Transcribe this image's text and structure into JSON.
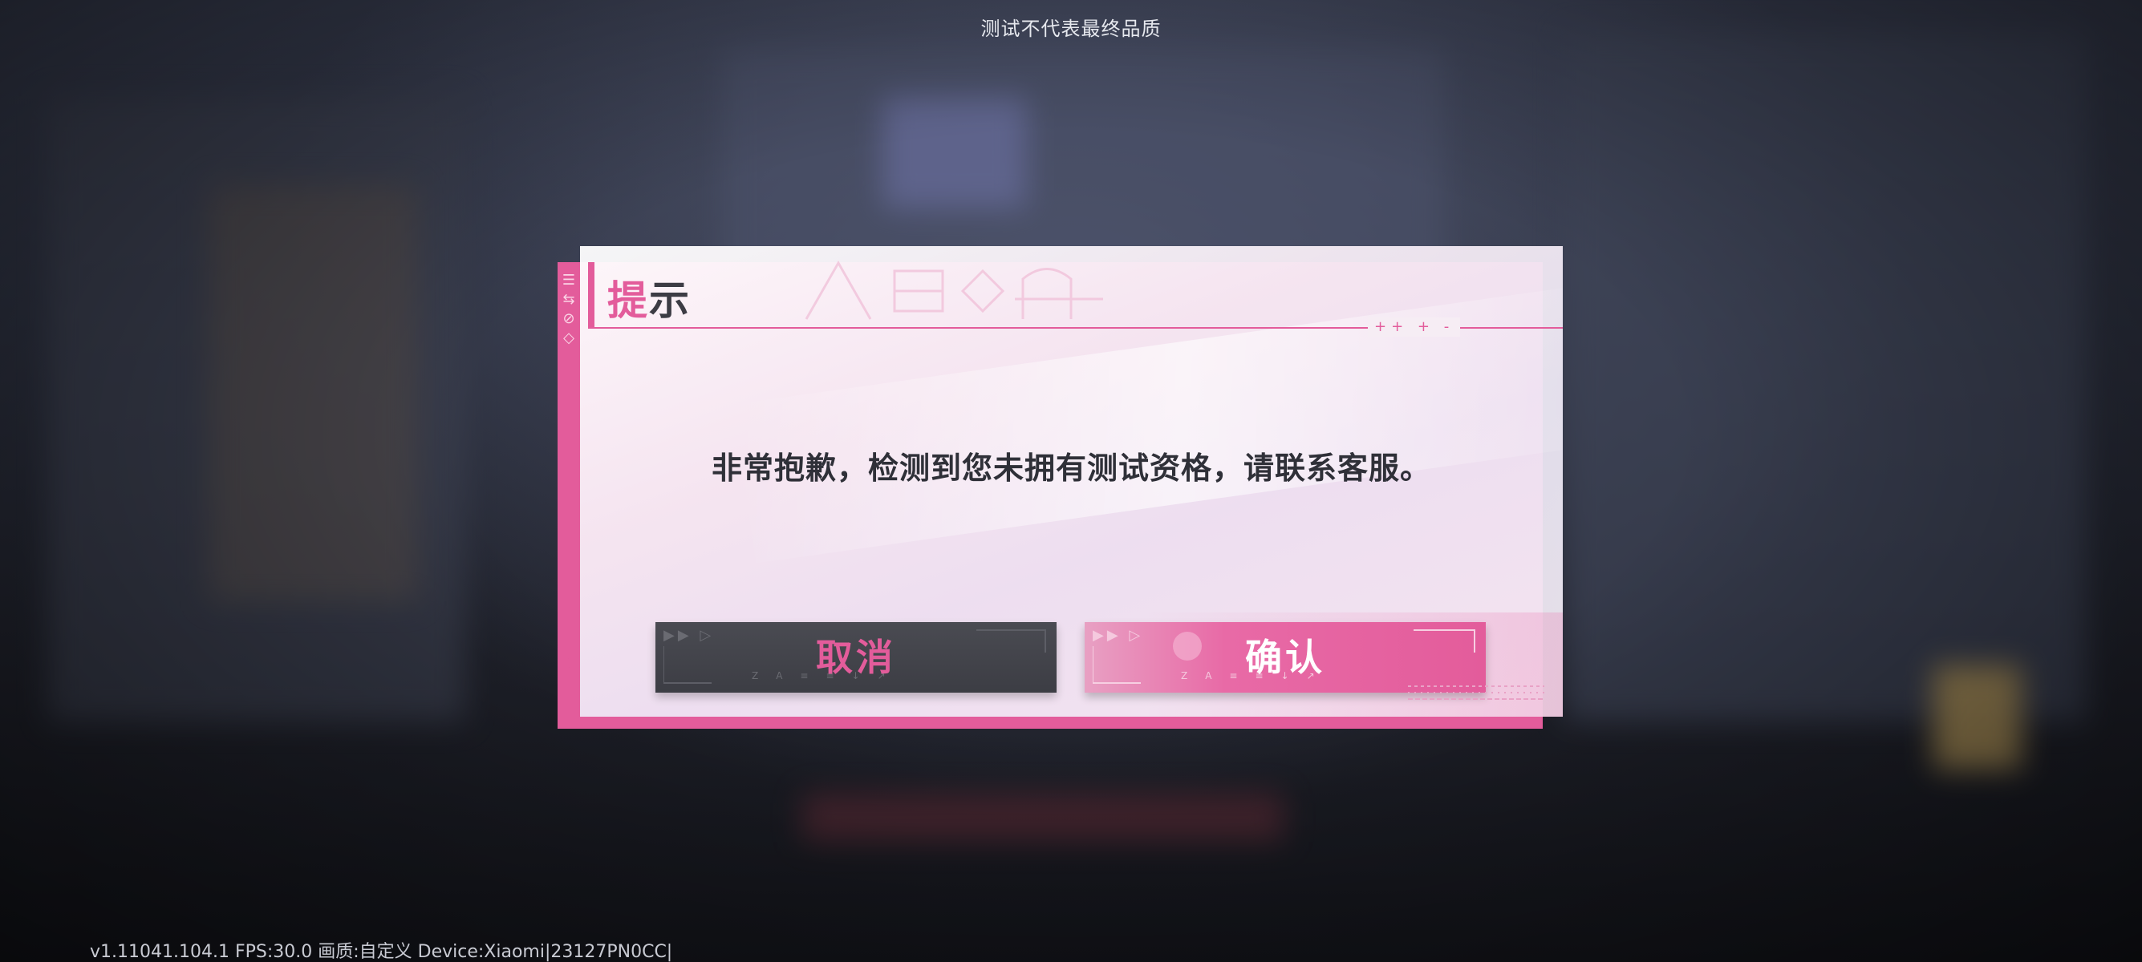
{
  "top_notice": "测试不代表最终品质",
  "version_text": "v1.11041.104.1 FPS:30.0 画质:自定义 Device:Xiaomi|23127PN0CC|",
  "dialog": {
    "title_first": "提",
    "title_rest": "示",
    "message": "非常抱歉，检测到您未拥有测试资格，请联系客服。",
    "cancel_label": "取消",
    "confirm_label": "确认",
    "title_deco": "++ + -"
  },
  "colors": {
    "accent": "#e35c9b",
    "cancel_bg": "#3c3d44",
    "text_dark": "#2f3038"
  },
  "icons": {
    "sidebar": [
      "menu-lines-icon",
      "arrows-icon",
      "slash-circle-icon",
      "diamond-icon"
    ],
    "button_arrows": "play-arrows-icon"
  }
}
